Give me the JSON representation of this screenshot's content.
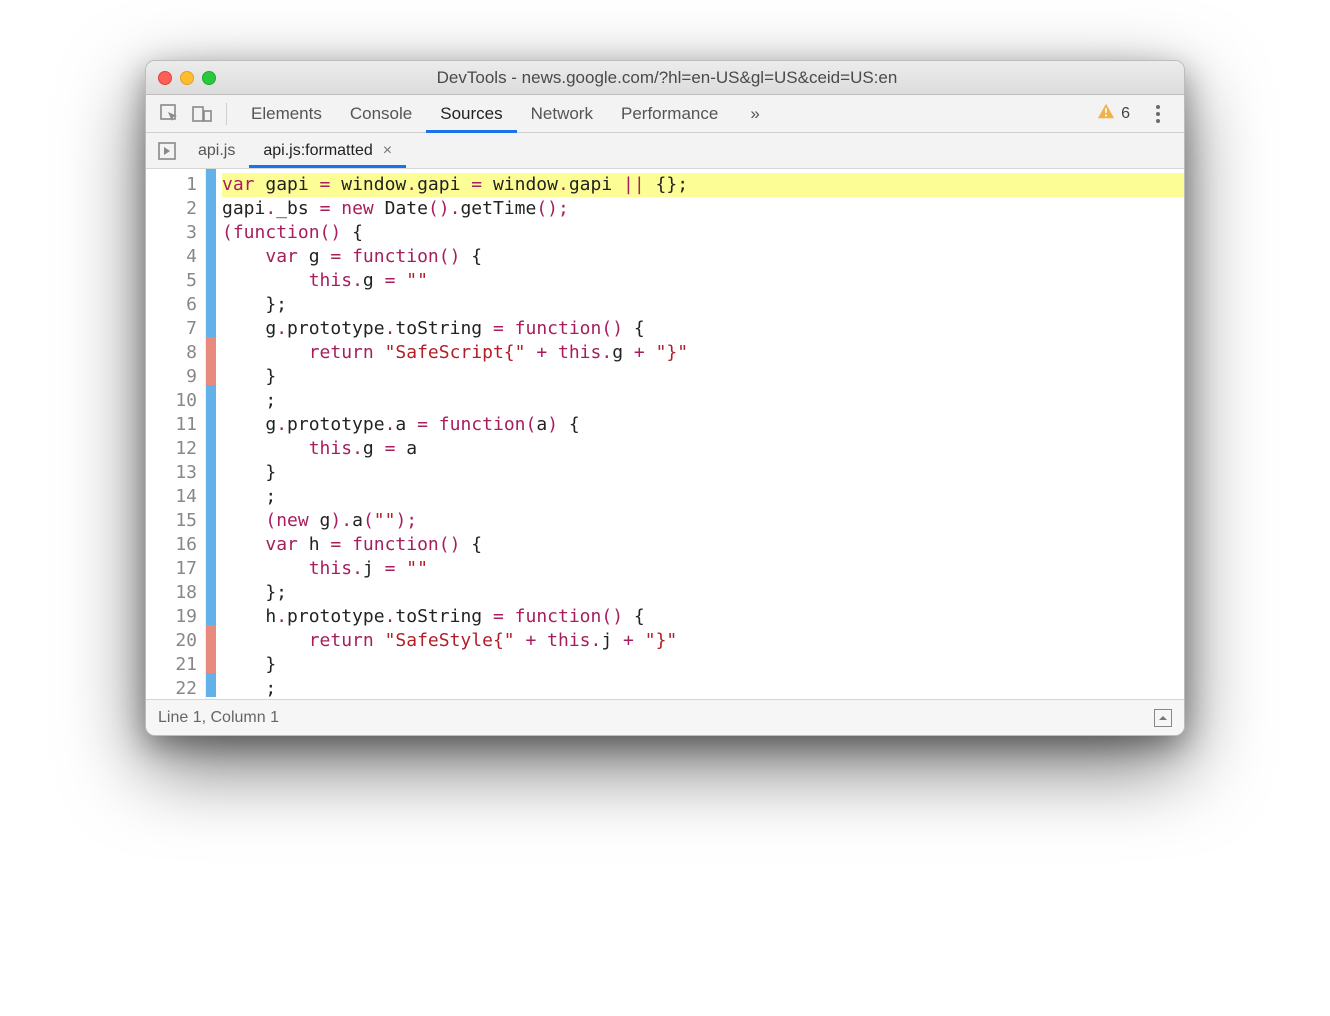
{
  "window": {
    "title": "DevTools - news.google.com/?hl=en-US&gl=US&ceid=US:en"
  },
  "panels": {
    "tabs": [
      "Elements",
      "Console",
      "Sources",
      "Network",
      "Performance"
    ],
    "active": "Sources",
    "overflow_glyph": "»",
    "warnings_count": "6"
  },
  "files": {
    "tabs": [
      {
        "label": "api.js",
        "active": false,
        "closable": false
      },
      {
        "label": "api.js:formatted",
        "active": true,
        "closable": true
      }
    ]
  },
  "code": {
    "lines": [
      {
        "n": 1,
        "cov": "blue",
        "hl": true,
        "tokens": [
          [
            "kw",
            "var"
          ],
          [
            "",
            " gapi "
          ],
          [
            "op",
            "="
          ],
          [
            "",
            " window"
          ],
          [
            "op",
            "."
          ],
          [
            "",
            "gapi "
          ],
          [
            "op",
            "="
          ],
          [
            "",
            " window"
          ],
          [
            "op",
            "."
          ],
          [
            "",
            "gapi "
          ],
          [
            "op",
            "||"
          ],
          [
            "",
            " {};"
          ]
        ]
      },
      {
        "n": 2,
        "cov": "blue",
        "tokens": [
          [
            "",
            "gapi"
          ],
          [
            "op",
            "."
          ],
          [
            "",
            "_bs "
          ],
          [
            "op",
            "="
          ],
          [
            "",
            " "
          ],
          [
            "kw",
            "new"
          ],
          [
            "",
            " Date"
          ],
          [
            "op",
            "()."
          ],
          [
            "",
            "getTime"
          ],
          [
            "op",
            "();"
          ]
        ]
      },
      {
        "n": 3,
        "cov": "blue",
        "tokens": [
          [
            "op",
            "("
          ],
          [
            "kw",
            "function"
          ],
          [
            "op",
            "()"
          ],
          [
            "",
            " {"
          ]
        ]
      },
      {
        "n": 4,
        "cov": "blue",
        "tokens": [
          [
            "",
            "    "
          ],
          [
            "kw",
            "var"
          ],
          [
            "",
            " g "
          ],
          [
            "op",
            "="
          ],
          [
            "",
            " "
          ],
          [
            "kw",
            "function"
          ],
          [
            "op",
            "()"
          ],
          [
            "",
            " {"
          ]
        ]
      },
      {
        "n": 5,
        "cov": "blue",
        "tokens": [
          [
            "",
            "        "
          ],
          [
            "kw",
            "this"
          ],
          [
            "op",
            "."
          ],
          [
            "",
            "g "
          ],
          [
            "op",
            "="
          ],
          [
            "",
            " "
          ],
          [
            "str",
            "\"\""
          ]
        ]
      },
      {
        "n": 6,
        "cov": "blue",
        "tokens": [
          [
            "",
            "    };"
          ]
        ]
      },
      {
        "n": 7,
        "cov": "blue",
        "tokens": [
          [
            "",
            "    g"
          ],
          [
            "op",
            "."
          ],
          [
            "",
            "prototype"
          ],
          [
            "op",
            "."
          ],
          [
            "",
            "toString "
          ],
          [
            "op",
            "="
          ],
          [
            "",
            " "
          ],
          [
            "kw",
            "function"
          ],
          [
            "op",
            "()"
          ],
          [
            "",
            " {"
          ]
        ]
      },
      {
        "n": 8,
        "cov": "red",
        "tokens": [
          [
            "",
            "        "
          ],
          [
            "kw",
            "return"
          ],
          [
            "",
            " "
          ],
          [
            "str",
            "\"SafeScript{\""
          ],
          [
            "",
            " "
          ],
          [
            "op",
            "+"
          ],
          [
            "",
            " "
          ],
          [
            "kw",
            "this"
          ],
          [
            "op",
            "."
          ],
          [
            "",
            "g "
          ],
          [
            "op",
            "+"
          ],
          [
            "",
            " "
          ],
          [
            "str",
            "\"}\""
          ]
        ]
      },
      {
        "n": 9,
        "cov": "red",
        "tokens": [
          [
            "",
            "    }"
          ]
        ]
      },
      {
        "n": 10,
        "cov": "blue",
        "tokens": [
          [
            "",
            "    ;"
          ]
        ]
      },
      {
        "n": 11,
        "cov": "blue",
        "tokens": [
          [
            "",
            "    g"
          ],
          [
            "op",
            "."
          ],
          [
            "",
            "prototype"
          ],
          [
            "op",
            "."
          ],
          [
            "",
            "a "
          ],
          [
            "op",
            "="
          ],
          [
            "",
            " "
          ],
          [
            "kw",
            "function"
          ],
          [
            "op",
            "("
          ],
          [
            "",
            "a"
          ],
          [
            "op",
            ")"
          ],
          [
            "",
            " {"
          ]
        ]
      },
      {
        "n": 12,
        "cov": "blue",
        "tokens": [
          [
            "",
            "        "
          ],
          [
            "kw",
            "this"
          ],
          [
            "op",
            "."
          ],
          [
            "",
            "g "
          ],
          [
            "op",
            "="
          ],
          [
            "",
            " a"
          ]
        ]
      },
      {
        "n": 13,
        "cov": "blue",
        "tokens": [
          [
            "",
            "    }"
          ]
        ]
      },
      {
        "n": 14,
        "cov": "blue",
        "tokens": [
          [
            "",
            "    ;"
          ]
        ]
      },
      {
        "n": 15,
        "cov": "blue",
        "tokens": [
          [
            "",
            "    "
          ],
          [
            "op",
            "("
          ],
          [
            "kw",
            "new"
          ],
          [
            "",
            " g"
          ],
          [
            "op",
            ")."
          ],
          [
            "",
            "a"
          ],
          [
            "op",
            "("
          ],
          [
            "str",
            "\"\""
          ],
          [
            "op",
            ");"
          ]
        ]
      },
      {
        "n": 16,
        "cov": "blue",
        "tokens": [
          [
            "",
            "    "
          ],
          [
            "kw",
            "var"
          ],
          [
            "",
            " h "
          ],
          [
            "op",
            "="
          ],
          [
            "",
            " "
          ],
          [
            "kw",
            "function"
          ],
          [
            "op",
            "()"
          ],
          [
            "",
            " {"
          ]
        ]
      },
      {
        "n": 17,
        "cov": "blue",
        "tokens": [
          [
            "",
            "        "
          ],
          [
            "kw",
            "this"
          ],
          [
            "op",
            "."
          ],
          [
            "",
            "j "
          ],
          [
            "op",
            "="
          ],
          [
            "",
            " "
          ],
          [
            "str",
            "\"\""
          ]
        ]
      },
      {
        "n": 18,
        "cov": "blue",
        "tokens": [
          [
            "",
            "    };"
          ]
        ]
      },
      {
        "n": 19,
        "cov": "blue",
        "tokens": [
          [
            "",
            "    h"
          ],
          [
            "op",
            "."
          ],
          [
            "",
            "prototype"
          ],
          [
            "op",
            "."
          ],
          [
            "",
            "toString "
          ],
          [
            "op",
            "="
          ],
          [
            "",
            " "
          ],
          [
            "kw",
            "function"
          ],
          [
            "op",
            "()"
          ],
          [
            "",
            " {"
          ]
        ]
      },
      {
        "n": 20,
        "cov": "red",
        "tokens": [
          [
            "",
            "        "
          ],
          [
            "kw",
            "return"
          ],
          [
            "",
            " "
          ],
          [
            "str",
            "\"SafeStyle{\""
          ],
          [
            "",
            " "
          ],
          [
            "op",
            "+"
          ],
          [
            "",
            " "
          ],
          [
            "kw",
            "this"
          ],
          [
            "op",
            "."
          ],
          [
            "",
            "j "
          ],
          [
            "op",
            "+"
          ],
          [
            "",
            " "
          ],
          [
            "str",
            "\"}\""
          ]
        ]
      },
      {
        "n": 21,
        "cov": "red",
        "tokens": [
          [
            "",
            "    }"
          ]
        ]
      },
      {
        "n": 22,
        "cov": "blue",
        "tokens": [
          [
            "",
            "    ;"
          ]
        ]
      }
    ]
  },
  "status": {
    "cursor": "Line 1, Column 1"
  }
}
